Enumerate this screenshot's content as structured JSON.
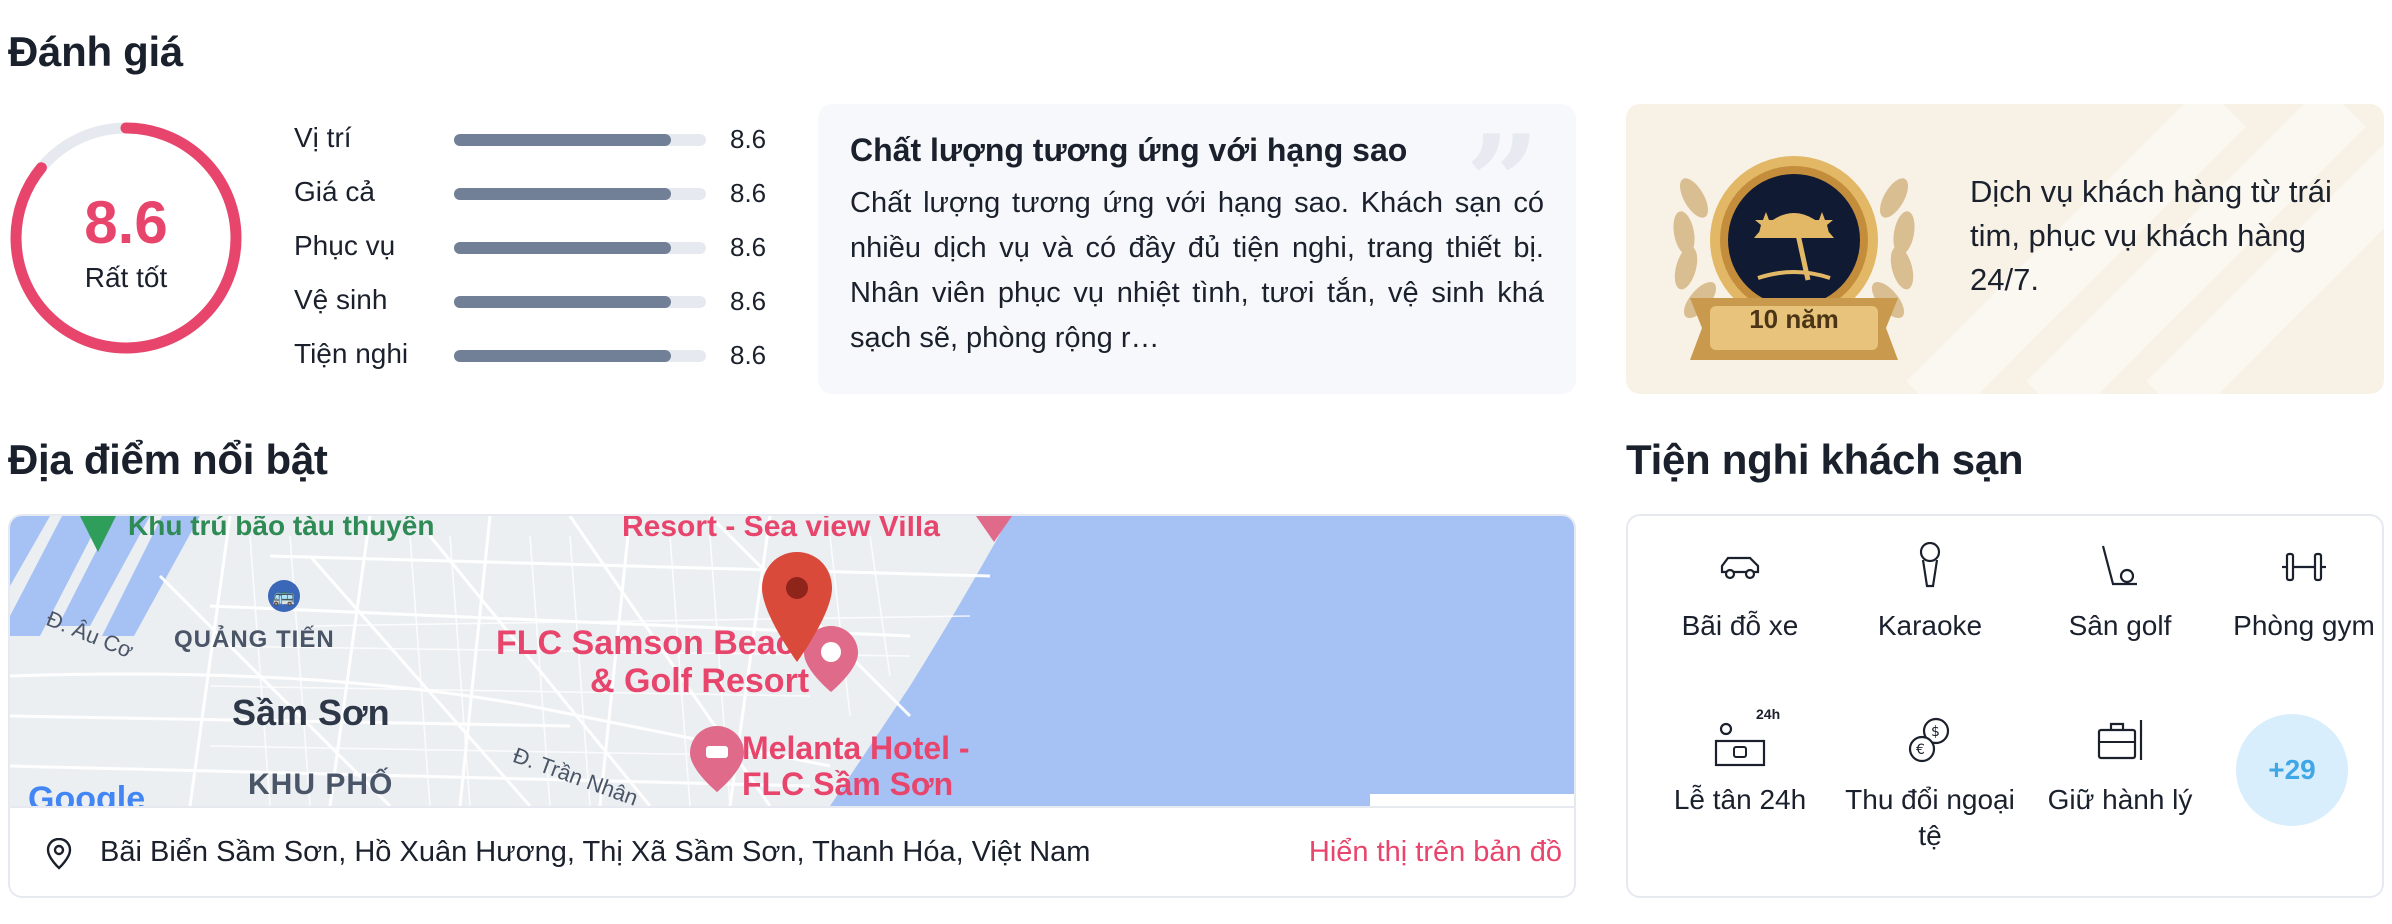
{
  "sections": {
    "reviews_title": "Đánh giá",
    "location_title": "Địa điểm nổi bật",
    "amenities_title": "Tiện nghi khách sạn"
  },
  "rating": {
    "score": "8.6",
    "score_fraction": 0.86,
    "label": "Rất tốt",
    "accent_color": "#e8456d"
  },
  "criteria": [
    {
      "label": "Vị trí",
      "value": "8.6",
      "fraction": 0.86
    },
    {
      "label": "Giá cả",
      "value": "8.6",
      "fraction": 0.86
    },
    {
      "label": "Phục vụ",
      "value": "8.6",
      "fraction": 0.86
    },
    {
      "label": "Vệ sinh",
      "value": "8.6",
      "fraction": 0.86
    },
    {
      "label": "Tiện nghi",
      "value": "8.6",
      "fraction": 0.86
    }
  ],
  "review": {
    "title": "Chất lượng tương ứng với hạng sao",
    "body": "Chất lượng tương ứng với hạng sao. Khách sạn có nhiều dịch vụ và có đầy đủ tiện nghi, trang thiết bị. Nhân viên phục vụ nhiệt tình, tươi tắn, vệ sinh khá sạch sẽ, phòng rộng r…"
  },
  "badge": {
    "years": "10 năm",
    "text": "Dịch vụ khách hàng từ trái tim, phục vụ khách hàng 24/7."
  },
  "map": {
    "labels": {
      "anchorage": "Khu trú bão tàu thuyền",
      "resort_villa": "Resort - Sea view Villa",
      "quang_tien": "QUẢNG TIẾN",
      "au_co": "Đ. Âu Cơ",
      "sam_son": "Sầm Sơn",
      "flc_1": "FLC Samson Beach",
      "flc_2": "& Golf Resort",
      "melanta_1": "Melanta Hotel -",
      "melanta_2": "FLC Sầm Sơn",
      "khu_pho": "KHU PHỐ",
      "tran_nhan": "Đ. Trần Nhân",
      "google": "Google"
    },
    "address": "Bãi Biển Sầm Sơn, Hồ Xuân Hương, Thị Xã Sầm Sơn, Thanh Hóa, Việt Nam",
    "show_on_map": "Hiển thị trên bản đồ"
  },
  "amenities": [
    {
      "label": "Bãi đỗ xe",
      "icon": "car-icon"
    },
    {
      "label": "Karaoke",
      "icon": "microphone-icon"
    },
    {
      "label": "Sân golf",
      "icon": "golf-icon"
    },
    {
      "label": "Phòng gym",
      "icon": "dumbbell-icon"
    },
    {
      "label": "Lễ tân 24h",
      "icon": "reception-24h-icon",
      "badge": "24h"
    },
    {
      "label": "Thu đổi ngoại tệ",
      "icon": "currency-exchange-icon"
    },
    {
      "label": "Giữ hành lý",
      "icon": "luggage-icon"
    }
  ],
  "amenities_more": "+29"
}
